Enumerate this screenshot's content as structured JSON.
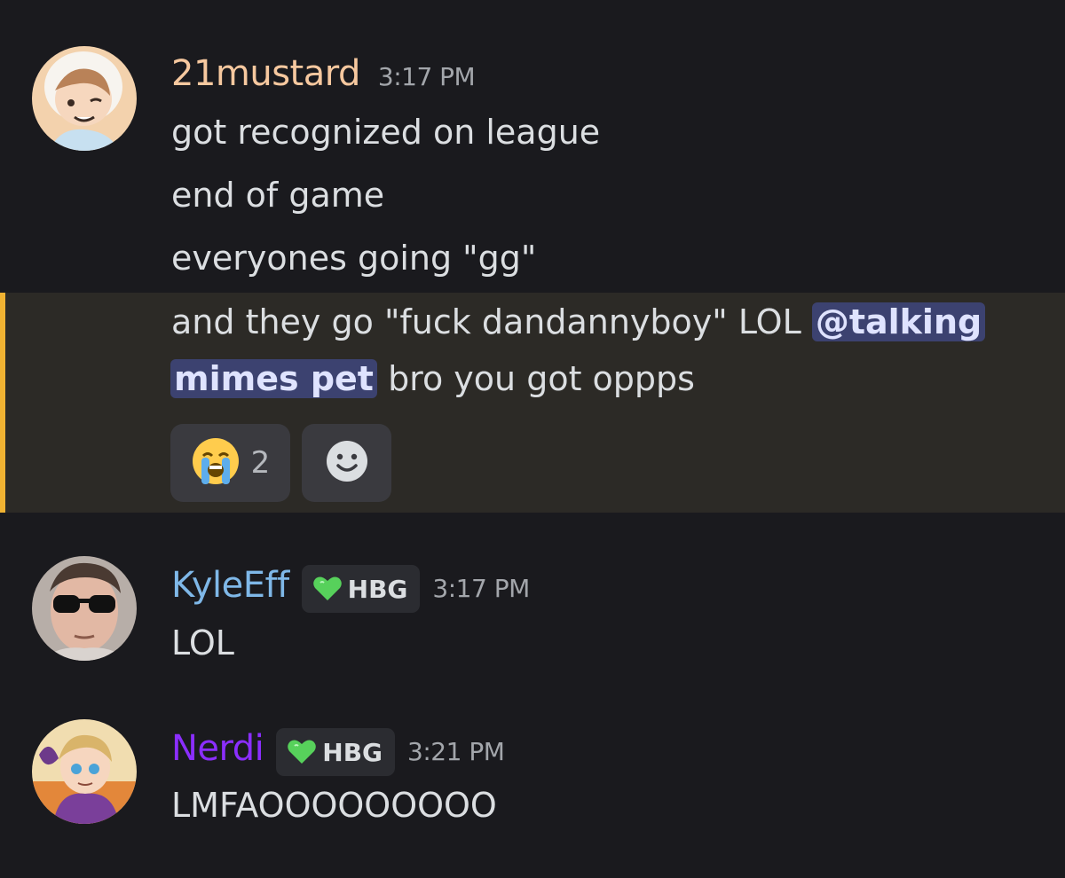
{
  "messages": [
    {
      "username": "21mustard",
      "username_color": "#f6c89f",
      "timestamp": "3:17 PM",
      "lines": [
        "got recognized on league",
        "end of game",
        "everyones going \"gg\""
      ],
      "highlighted_line": {
        "pre": "and they go \"fuck dandannyboy\" LOL ",
        "mention_part1": "@talking",
        "mention_part2": "mimes pet",
        "post": " bro you got oppps"
      },
      "reactions": [
        {
          "emoji": "loudly-crying-face",
          "count": "2"
        }
      ],
      "add_reaction_icon": "smiley-icon"
    },
    {
      "username": "KyleEff",
      "username_color": "#7fb8e8",
      "tag": "HBG",
      "timestamp": "3:17 PM",
      "lines": [
        "LOL"
      ]
    },
    {
      "username": "Nerdi",
      "username_color": "#8b2eff",
      "tag": "HBG",
      "timestamp": "3:21 PM",
      "lines": [
        "LMFAOOOOOOOOO"
      ]
    }
  ],
  "colors": {
    "background": "#1a1a1e",
    "highlight_background": "#2c2a26",
    "highlight_bar": "#f0b232",
    "mention_background": "#3c4270",
    "tag_heart": "#57d15b"
  }
}
